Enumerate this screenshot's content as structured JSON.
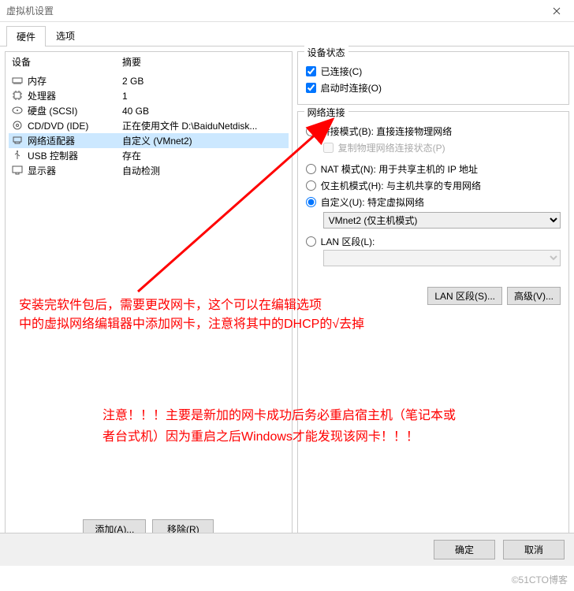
{
  "titlebar": {
    "title": "虚拟机设置"
  },
  "tabs": {
    "hardware": "硬件",
    "options": "选项"
  },
  "device_header": {
    "device": "设备",
    "summary": "摘要"
  },
  "devices": [
    {
      "name": "内存",
      "summary": "2 GB"
    },
    {
      "name": "处理器",
      "summary": "1"
    },
    {
      "name": "硬盘 (SCSI)",
      "summary": "40 GB"
    },
    {
      "name": "CD/DVD (IDE)",
      "summary": "正在使用文件 D:\\BaiduNetdisk..."
    },
    {
      "name": "网络适配器",
      "summary": "自定义 (VMnet2)"
    },
    {
      "name": "USB 控制器",
      "summary": "存在"
    },
    {
      "name": "显示器",
      "summary": "自动检测"
    }
  ],
  "left_buttons": {
    "add": "添加(A)...",
    "remove": "移除(R)"
  },
  "status_group": {
    "legend": "设备状态",
    "connected": "已连接(C)",
    "connect_at_power": "启动时连接(O)"
  },
  "net_group": {
    "legend": "网络连接",
    "bridged": "桥接模式(B): 直接连接物理网络",
    "replicate": "复制物理网络连接状态(P)",
    "nat": "NAT 模式(N): 用于共享主机的 IP 地址",
    "hostonly": "仅主机模式(H): 与主机共享的专用网络",
    "custom": "自定义(U): 特定虚拟网络",
    "custom_select": "VMnet2 (仅主机模式)",
    "lan": "LAN 区段(L):",
    "lan_btn": "LAN 区段(S)...",
    "adv_btn": "高级(V)..."
  },
  "footer": {
    "ok": "确定",
    "cancel": "取消"
  },
  "annotation1_l1": "安装完软件包后，需要更改网卡，这个可以在编辑选项",
  "annotation1_l2": "中的虚拟网络编辑器中添加网卡，注意将其中的DHCP的√去掉",
  "annotation2_l1": "注意！！！主要是新加的网卡成功后务必重启宿主机（笔记本或",
  "annotation2_l2": "者台式机）因为重启之后Windows才能发现该网卡！！！",
  "watermark": "©51CTO博客"
}
